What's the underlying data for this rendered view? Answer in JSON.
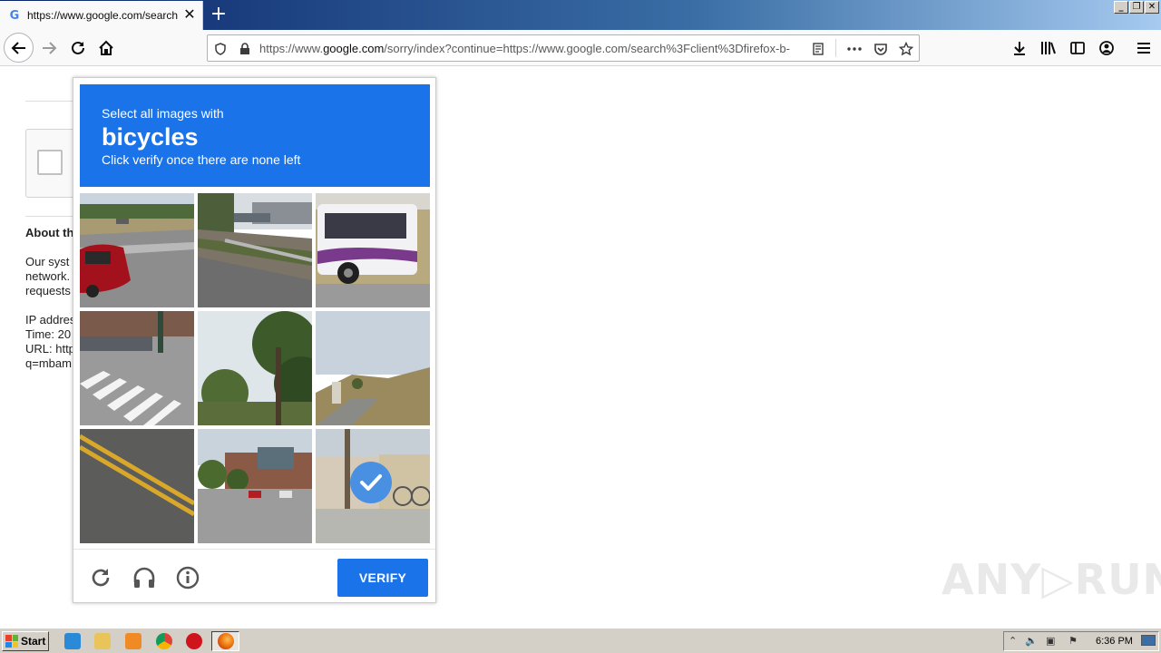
{
  "browser": {
    "tab": {
      "favicon": "G",
      "title": "https://www.google.com/search?c",
      "close": "✕"
    },
    "new_tab": "+",
    "window_controls": {
      "minimize": "_",
      "restore": "❐",
      "close": "✕"
    },
    "url": {
      "prefix": "https://www.",
      "host": "google.com",
      "path": "/sorry/index?continue=https://www.google.com/search%3Fclient%3Dfirefox-b-"
    },
    "toolbar_icons": [
      "back-icon",
      "forward-icon",
      "reload-icon",
      "home-icon",
      "download-icon",
      "library-icon",
      "sidebar-icon",
      "account-icon",
      "menu-icon"
    ],
    "url_icons": [
      "shield-icon",
      "lock-icon",
      "reader-icon",
      "more-icon",
      "pocket-icon",
      "star-icon"
    ]
  },
  "page": {
    "about_title": "About th",
    "para1": [
      "Our syst",
      "network.",
      "requests"
    ],
    "para2": [
      "IP addres",
      "Time: 20",
      "URL: http",
      "q=mbam"
    ]
  },
  "challenge": {
    "instruction_line1": "Select all images with",
    "keyword": "bicycles",
    "instruction_line3": "Click verify once there are none left",
    "selected_tile": 9,
    "verify_label": "VERIFY",
    "footer_icons": [
      "reload-icon",
      "audio-icon",
      "info-icon"
    ],
    "colors": {
      "header": "#1a73e8",
      "button": "#1a73e8",
      "check": "#4a90e2"
    }
  },
  "watermark": "ANY▷RUN",
  "taskbar": {
    "start_label": "Start",
    "clock": "6:36 PM",
    "apps": [
      "ie-icon",
      "explorer-icon",
      "media-player-icon",
      "chrome-icon",
      "opera-icon",
      "firefox-icon"
    ]
  }
}
